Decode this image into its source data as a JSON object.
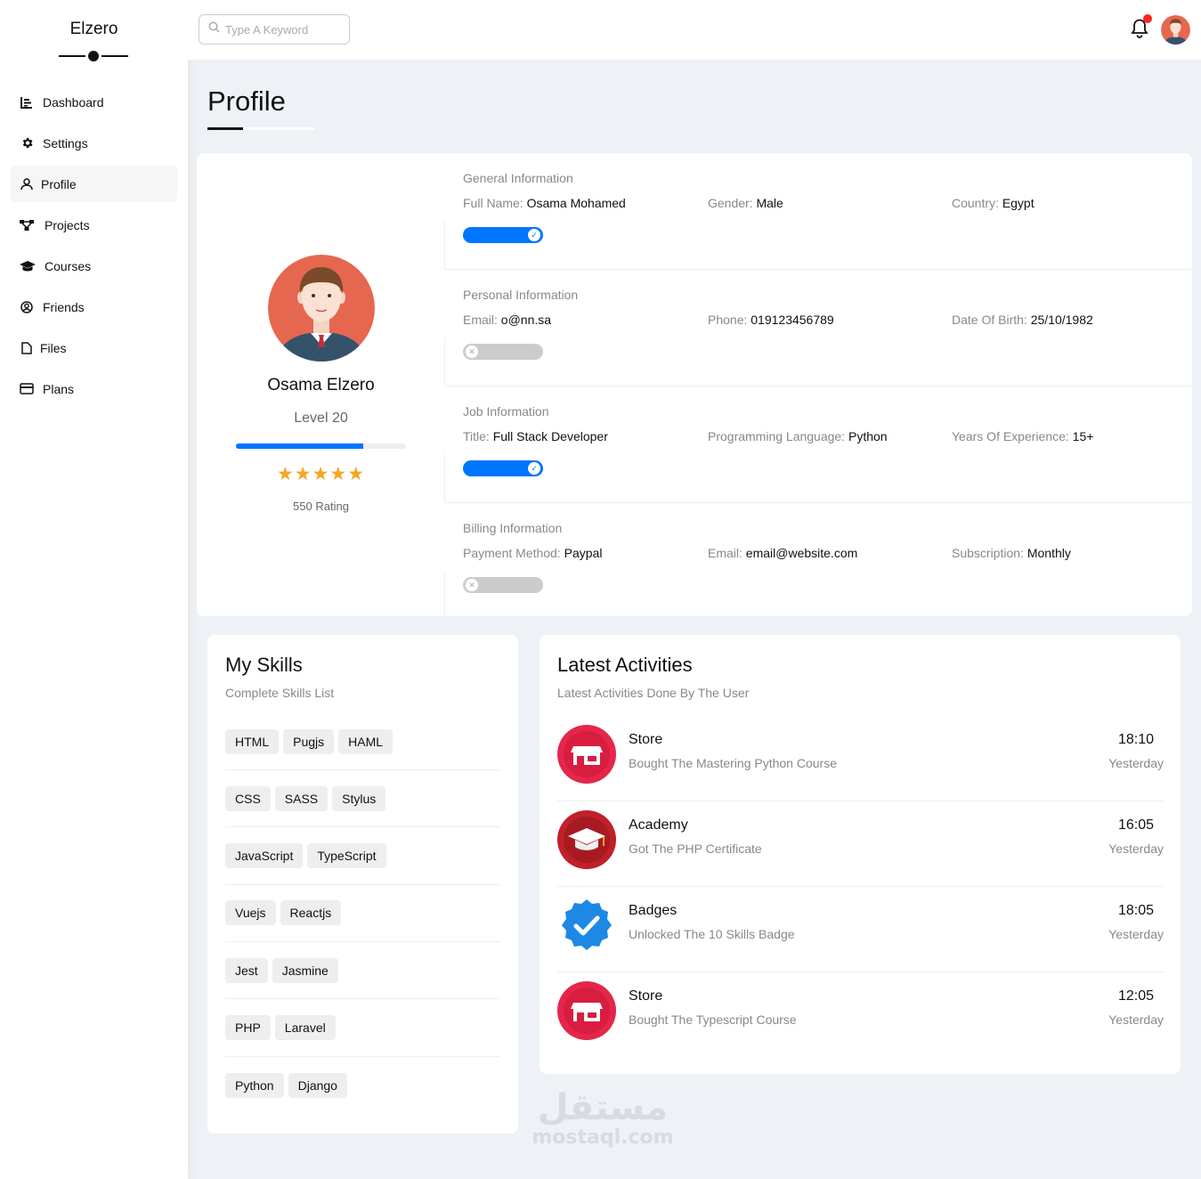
{
  "brand": {
    "name": "Elzero"
  },
  "sidebar": {
    "items": [
      {
        "label": "Dashboard",
        "icon": "chart-icon"
      },
      {
        "label": "Settings",
        "icon": "gear-icon"
      },
      {
        "label": "Profile",
        "icon": "user-icon"
      },
      {
        "label": "Projects",
        "icon": "diagram-icon"
      },
      {
        "label": "Courses",
        "icon": "graduation-cap-icon"
      },
      {
        "label": "Friends",
        "icon": "user-circle-icon"
      },
      {
        "label": "Files",
        "icon": "file-icon"
      },
      {
        "label": "Plans",
        "icon": "credit-card-icon"
      }
    ],
    "active": "Profile"
  },
  "header": {
    "search_placeholder": "Type A Keyword",
    "notification_dot_color": "#ff2222"
  },
  "page": {
    "title": "Profile"
  },
  "profile": {
    "name": "Osama Elzero",
    "level": "Level 20",
    "level_progress_percent": 75,
    "stars": 5,
    "rating": "550 Rating",
    "sections": [
      {
        "title": "General Information",
        "fields": [
          {
            "label": "Full Name:",
            "value": "Osama Mohamed"
          },
          {
            "label": "Gender:",
            "value": "Male"
          },
          {
            "label": "Country:",
            "value": "Egypt"
          }
        ],
        "toggle": "on"
      },
      {
        "title": "Personal Information",
        "fields": [
          {
            "label": "Email:",
            "value": "o@nn.sa"
          },
          {
            "label": "Phone:",
            "value": "019123456789"
          },
          {
            "label": "Date Of Birth:",
            "value": "25/10/1982"
          }
        ],
        "toggle": "off"
      },
      {
        "title": "Job Information",
        "fields": [
          {
            "label": "Title:",
            "value": "Full Stack Developer"
          },
          {
            "label": "Programming Language:",
            "value": "Python"
          },
          {
            "label": "Years Of Experience:",
            "value": "15+"
          }
        ],
        "toggle": "on"
      },
      {
        "title": "Billing Information",
        "fields": [
          {
            "label": "Payment Method:",
            "value": "Paypal"
          },
          {
            "label": "Email:",
            "value": "email@website.com"
          },
          {
            "label": "Subscription:",
            "value": "Monthly"
          }
        ],
        "toggle": "off"
      }
    ]
  },
  "skills": {
    "title": "My Skills",
    "subtitle": "Complete Skills List",
    "rows": [
      [
        "HTML",
        "Pugjs",
        "HAML"
      ],
      [
        "CSS",
        "SASS",
        "Stylus"
      ],
      [
        "JavaScript",
        "TypeScript"
      ],
      [
        "Vuejs",
        "Reactjs"
      ],
      [
        "Jest",
        "Jasmine"
      ],
      [
        "PHP",
        "Laravel"
      ],
      [
        "Python",
        "Django"
      ]
    ]
  },
  "activities": {
    "title": "Latest Activities",
    "subtitle": "Latest Activities Done By The User",
    "items": [
      {
        "name": "Store",
        "desc": "Bought The Mastering Python Course",
        "time": "18:10",
        "day": "Yesterday",
        "icon": "store-icon"
      },
      {
        "name": "Academy",
        "desc": "Got The PHP Certificate",
        "time": "16:05",
        "day": "Yesterday",
        "icon": "academy-icon"
      },
      {
        "name": "Badges",
        "desc": "Unlocked The 10 Skills Badge",
        "time": "18:05",
        "day": "Yesterday",
        "icon": "badge-check-icon"
      },
      {
        "name": "Store",
        "desc": "Bought The Typescript Course",
        "time": "12:05",
        "day": "Yesterday",
        "icon": "store-icon"
      }
    ]
  },
  "watermark": {
    "arabic": "مستقل",
    "latin": "mostaql.com"
  },
  "colors": {
    "accent": "#0075ff",
    "star": "#f5a623",
    "store": "#e5264b",
    "academy": "#c0202a",
    "badge": "#1e88e5"
  }
}
